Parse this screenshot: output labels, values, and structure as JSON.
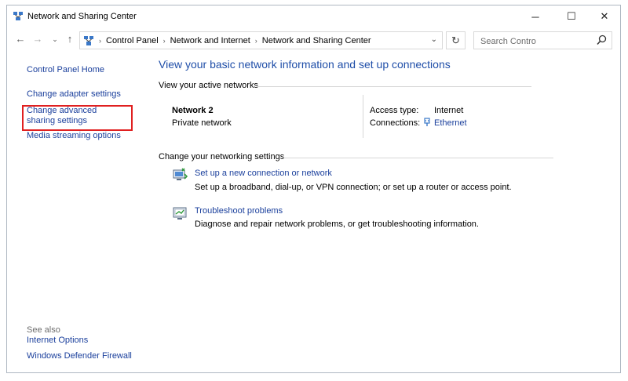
{
  "window": {
    "title": "Network and Sharing Center",
    "controls": {
      "minimize": "─",
      "maximize": "☐",
      "close": "✕"
    }
  },
  "address": {
    "breadcrumbs": [
      "Control Panel",
      "Network and Internet",
      "Network and Sharing Center"
    ],
    "search_placeholder": "Search Contro"
  },
  "sidebar": {
    "items": [
      {
        "label": "Control Panel Home"
      },
      {
        "label": "Change adapter settings"
      },
      {
        "label": "Change advanced sharing settings"
      },
      {
        "label": "Media streaming options"
      }
    ],
    "see_also_label": "See also",
    "see_also": [
      {
        "label": "Internet Options"
      },
      {
        "label": "Windows Defender Firewall"
      }
    ]
  },
  "main": {
    "title": "View your basic network information and set up connections",
    "active_networks_label": "View your active networks",
    "network": {
      "name": "Network 2",
      "type": "Private network",
      "access_type_label": "Access type:",
      "access_type_value": "Internet",
      "connections_label": "Connections:",
      "connections_value": "Ethernet"
    },
    "change_settings_label": "Change your networking settings",
    "tasks": [
      {
        "link": "Set up a new connection or network",
        "description": "Set up a broadband, dial-up, or VPN connection; or set up a router or access point."
      },
      {
        "link": "Troubleshoot problems",
        "description": "Diagnose and repair network problems, or get troubleshooting information."
      }
    ]
  },
  "colors": {
    "link": "#1a3f9c",
    "title": "#1f4ea8",
    "highlight": "#e02020"
  }
}
